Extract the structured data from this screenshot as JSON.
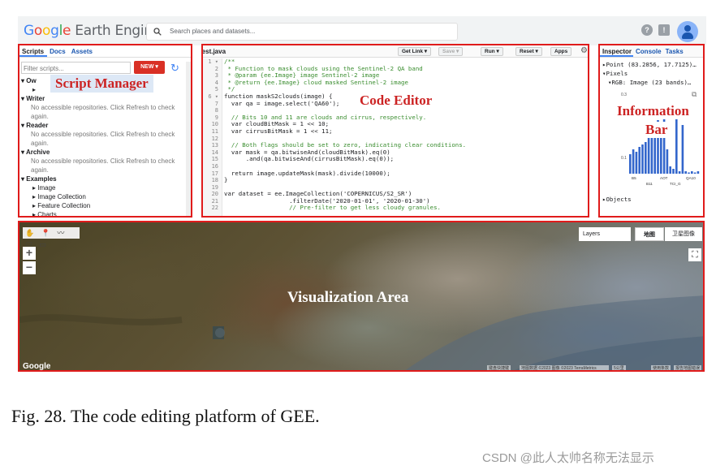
{
  "topbar": {
    "logo_google": [
      "G",
      "o",
      "o",
      "g",
      "l",
      "e"
    ],
    "logo_rest": " Earth Engine",
    "search_placeholder": "Search places and datasets...",
    "help_icon": "?",
    "feedback_icon": "!"
  },
  "left_panel": {
    "tabs": [
      "Scripts",
      "Docs",
      "Assets"
    ],
    "filter_placeholder": "Filter scripts...",
    "new_button": "NEW ▾",
    "tree": [
      {
        "kind": "hd",
        "text": "▾ Ow"
      },
      {
        "kind": "it",
        "text": "▸"
      },
      {
        "kind": "hd",
        "text": "▾ Writer"
      },
      {
        "kind": "msg",
        "text": "No accessible repositories. Click Refresh to check"
      },
      {
        "kind": "msg",
        "text": "again."
      },
      {
        "kind": "hd",
        "text": "▾ Reader"
      },
      {
        "kind": "msg",
        "text": "No accessible repositories. Click Refresh to check"
      },
      {
        "kind": "msg",
        "text": "again."
      },
      {
        "kind": "hd",
        "text": "▾ Archive"
      },
      {
        "kind": "msg",
        "text": "No accessible repositories. Click Refresh to check"
      },
      {
        "kind": "msg",
        "text": "again."
      },
      {
        "kind": "hd",
        "text": "▾ Examples"
      },
      {
        "kind": "it",
        "text": "▸ Image"
      },
      {
        "kind": "it",
        "text": "▸ Image Collection"
      },
      {
        "kind": "it",
        "text": "▸ Feature Collection"
      },
      {
        "kind": "it",
        "text": "▸ Charts"
      }
    ],
    "overlay_label": "Script Manager"
  },
  "code_editor": {
    "filename": "test.java",
    "buttons": {
      "get_link": "Get Link ▾",
      "save": "Save ▾",
      "run": "Run ▾",
      "reset": "Reset ▾",
      "apps": "Apps"
    },
    "line_numbers": [
      "1 ▾",
      "2",
      "3",
      "4",
      "5",
      "6 ▾",
      "7",
      "8",
      "9",
      "10",
      "11",
      "12",
      "13",
      "14",
      "15",
      "16",
      "17",
      "18",
      "19",
      "20",
      "21",
      "22"
    ],
    "code_lines": [
      "/**",
      " * Function to mask clouds using the Sentinel-2 QA band",
      " * @param {ee.Image} image Sentinel-2 image",
      " * @return {ee.Image} cloud masked Sentinel-2 image",
      " */",
      "function maskS2clouds(image) {",
      "  var qa = image.select('QA60');",
      "",
      "  // Bits 10 and 11 are clouds and cirrus, respectively.",
      "  var cloudBitMask = 1 << 10;",
      "  var cirrusBitMask = 1 << 11;",
      "",
      "  // Both flags should be set to zero, indicating clear conditions.",
      "  var mask = qa.bitwiseAnd(cloudBitMask).eq(0)",
      "      .and(qa.bitwiseAnd(cirrusBitMask).eq(0));",
      "",
      "  return image.updateMask(mask).divide(10000);",
      "}",
      "",
      "var dataset = ee.ImageCollection('COPERNICUS/S2_SR')",
      "                  .filterDate('2020-01-01', '2020-01-30')",
      "                  // Pre-filter to get less cloudy granules."
    ],
    "overlay_label": "Code Editor"
  },
  "inspector": {
    "tabs": [
      "Inspector",
      "Console",
      "Tasks"
    ],
    "point": "▸Point (83.2856, 17.7125)…",
    "pixels": "▾Pixels",
    "rgb": "▾RGB: Image (23 bands)…",
    "chart_tick_top": "0.3",
    "chart_tick_mid": "0.1",
    "chart_bar_labels": [
      "B5",
      "B11",
      "AOT",
      "QA10",
      "TCI_G"
    ],
    "chart_bar_values": [
      0.08,
      0.1,
      0.09,
      0.11,
      0.12,
      0.13,
      0.16,
      0.19,
      0.21,
      0.22,
      0.2,
      0.24,
      0.1,
      0.03,
      0.02,
      0.28,
      0.01,
      0.2,
      0.01,
      0.005,
      0.01,
      0.005,
      0.01
    ],
    "objects": "▸Objects",
    "overlay_label_1": "Information",
    "overlay_label_2": "Bar"
  },
  "map": {
    "tools": "✋ 📍 〰 ▱ ▭",
    "zoom_in": "+",
    "zoom_out": "−",
    "layers": "Layers",
    "map_type_map": "地图",
    "map_type_sat": "卫星图像",
    "fullscreen": "⛶",
    "google_wm": "Google",
    "footer_1": "键盘快捷键",
    "footer_2": "地图数据 ©2023 图像 ©2023 TerraMetrics",
    "footer_3": "5公里",
    "footer_4": "使用条款",
    "footer_5": "报告地图错误",
    "overlay_label": "Visualization Area"
  },
  "caption": "Fig. 28.   The code editing platform of GEE.",
  "watermark": "CSDN @此人太帅名称无法显示"
}
